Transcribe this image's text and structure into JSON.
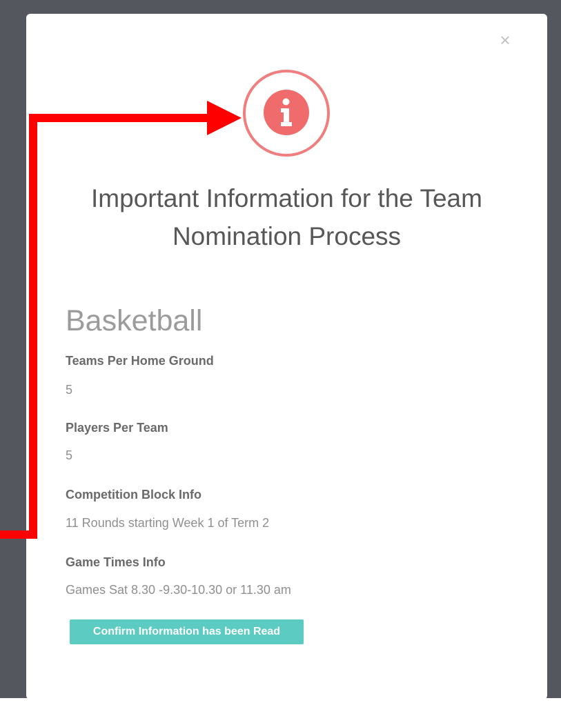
{
  "modal": {
    "close_symbol": "×",
    "icon": "info-circle-icon",
    "title": "Important Information for the Team Nomination Process",
    "sport": "Basketball",
    "fields": [
      {
        "label": "Teams Per Home Ground",
        "value": "5"
      },
      {
        "label": "Players Per Team",
        "value": "5"
      },
      {
        "label": "Competition Block Info",
        "value": "11 Rounds starting Week 1 of Term 2"
      },
      {
        "label": "Game Times Info",
        "value": "Games Sat 8.30 -9.30-10.30 or 11.30 am"
      }
    ],
    "confirm_label": "Confirm Information has been Read"
  },
  "colors": {
    "overlay": "#54575e",
    "icon_red": "#f06b6b",
    "button_teal": "#5ccbc2",
    "annotation_red": "#ff0000"
  }
}
